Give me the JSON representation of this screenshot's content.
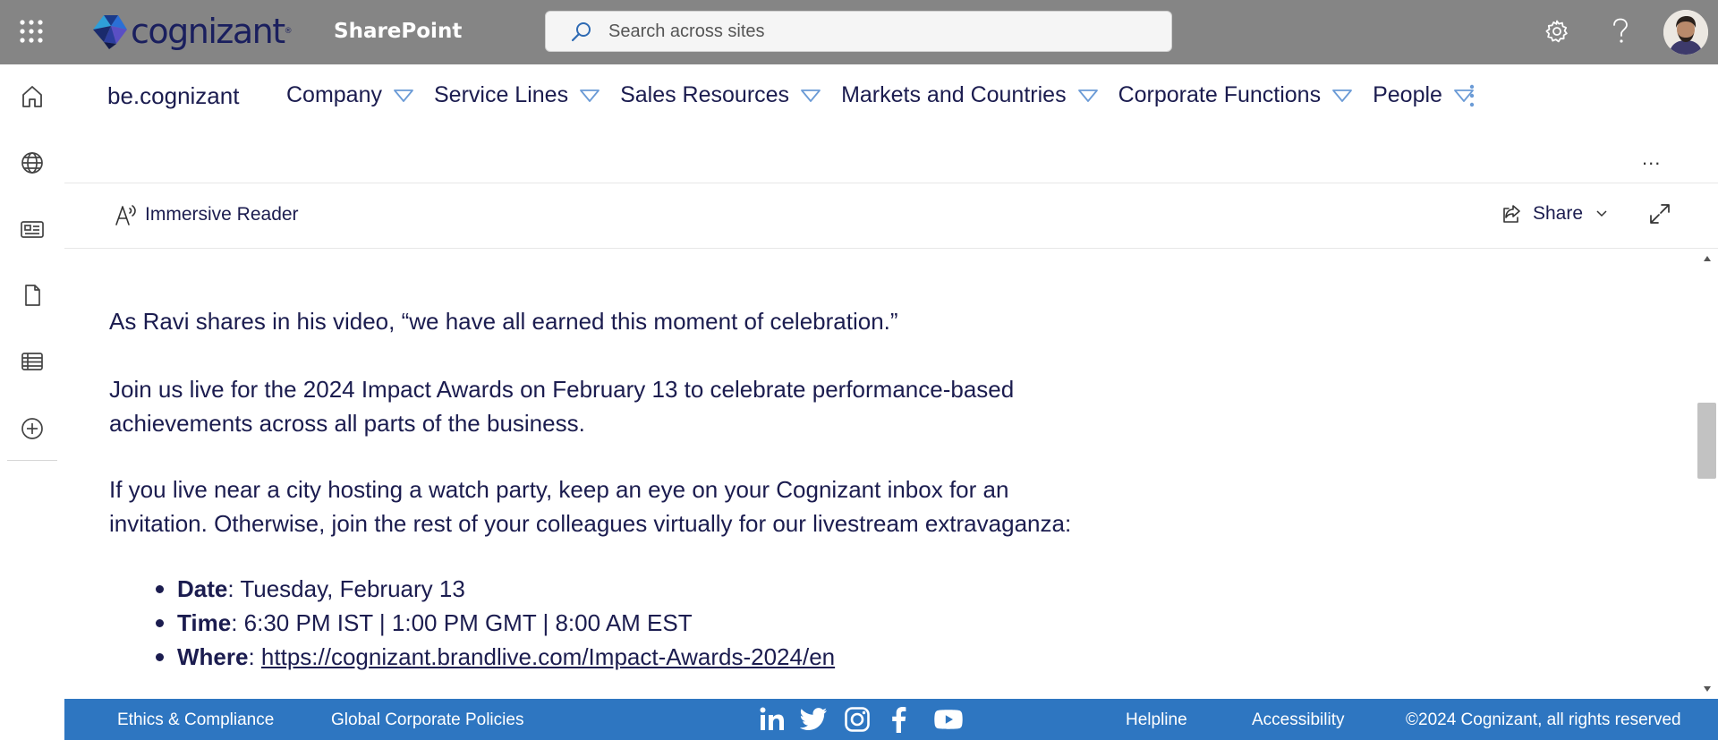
{
  "suitebar": {
    "logo_text": "cognizant",
    "app_name": "SharePoint",
    "search_placeholder": "Search across sites",
    "icons": [
      "waffle-icon",
      "gear-icon",
      "help-icon",
      "avatar"
    ]
  },
  "leftrail": {
    "items": [
      "home-icon",
      "globe-icon",
      "news-icon",
      "document-icon",
      "list-icon",
      "add-icon"
    ]
  },
  "hubnav": {
    "site_title": "be.cognizant",
    "items": [
      {
        "label": "Company"
      },
      {
        "label": "Service Lines"
      },
      {
        "label": "Sales Resources"
      },
      {
        "label": "Markets and Countries"
      },
      {
        "label": "Corporate Functions"
      },
      {
        "label": "People"
      }
    ],
    "ellipsis": "..."
  },
  "cmdbar": {
    "immersive_reader": "Immersive Reader",
    "share": "Share"
  },
  "article": {
    "p1": "As Ravi shares in his video, “we have all earned this moment of celebration.”",
    "p2_line1": "Join us live for the 2024 Impact Awards on February 13 to celebrate performance-based",
    "p2_line2": "achievements across all parts of the business.",
    "p3_line1": "If you live near a city hosting a watch party, keep an eye on your Cognizant inbox for an",
    "p3_line2": "invitation. Otherwise, join the rest of your colleagues virtually for our livestream extravaganza:",
    "details": [
      {
        "label": "Date",
        "value": ": Tuesday, February 13"
      },
      {
        "label": "Time",
        "value": ": 6:30 PM IST | 1:00 PM GMT | 8:00 AM EST"
      },
      {
        "label": "Where",
        "value": ": ",
        "link": "https://cognizant.brandlive.com/Impact-Awards-2024/en"
      }
    ]
  },
  "footer": {
    "ethics": "Ethics & Compliance",
    "policies": "Global Corporate Policies",
    "helpline": "Helpline",
    "accessibility": "Accessibility",
    "copyright": "©2024 Cognizant, all rights reserved",
    "social": [
      "linkedin-icon",
      "twitter-icon",
      "instagram-icon",
      "facebook-icon",
      "youtube-icon"
    ]
  },
  "colors": {
    "suitebar_bg": "#858585",
    "footer_bg": "#2e76c1",
    "text": "#1b1c4f",
    "nav_chevron": "#6b9bd6"
  }
}
